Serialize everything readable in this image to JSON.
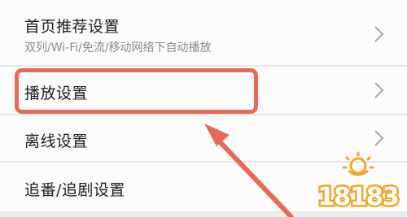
{
  "settings": {
    "items": [
      {
        "title": "首页推荐设置",
        "subtitle": "双列/Wi-Fi/免流/移动网络下自动播放"
      },
      {
        "title": "播放设置"
      },
      {
        "title": "离线设置"
      },
      {
        "title": "追番/追剧设置"
      }
    ]
  },
  "colors": {
    "highlight": "#e56a58",
    "arrow": "#e56a58",
    "watermark": "#f2a62a"
  },
  "watermark": {
    "text": "18183"
  }
}
